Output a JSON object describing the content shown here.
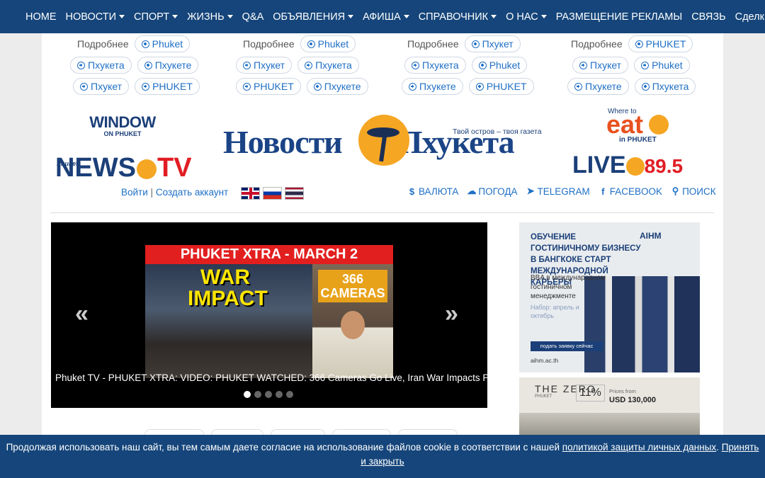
{
  "nav": {
    "items": [
      {
        "label": "HOME",
        "dropdown": false
      },
      {
        "label": "НОВОСТИ",
        "dropdown": true
      },
      {
        "label": "СПОРТ",
        "dropdown": true
      },
      {
        "label": "ЖИЗНЬ",
        "dropdown": true
      },
      {
        "label": "Q&A",
        "dropdown": false
      },
      {
        "label": "ОБЪЯВЛЕНИЯ",
        "dropdown": true
      },
      {
        "label": "АФИША",
        "dropdown": true
      },
      {
        "label": "СПРАВОЧНИК",
        "dropdown": true
      },
      {
        "label": "О НАС",
        "dropdown": true
      },
      {
        "label": "РАЗМЕЩЕНИЕ РЕКЛАМЫ",
        "dropdown": false
      },
      {
        "label": "СВЯЗЬ",
        "dropdown": false
      },
      {
        "label": "Сделки",
        "dropdown": false
      }
    ]
  },
  "tags": [
    {
      "label": "Подробнее",
      "rows": [
        [
          "Phuket"
        ],
        [
          "Пхукета",
          "Пхукете"
        ],
        [
          "Пхукет",
          "PHUKET"
        ]
      ]
    },
    {
      "label": "Подробнее",
      "rows": [
        [
          "Phuket"
        ],
        [
          "Пхукет",
          "Пхукета"
        ],
        [
          "PHUKET",
          "Пхукете"
        ]
      ]
    },
    {
      "label": "Подробнее",
      "rows": [
        [
          "Пхукет"
        ],
        [
          "Пхукета",
          "Phuket"
        ],
        [
          "Пхукете",
          "PHUKET"
        ]
      ]
    },
    {
      "label": "Подробнее",
      "rows": [
        [
          "PHUKET"
        ],
        [
          "Пхукет",
          "Phuket"
        ],
        [
          "Пхукете",
          "Пхукета"
        ]
      ]
    }
  ],
  "header": {
    "window_logo": "WINDOW",
    "window_logo_sub": "ON PHUKET",
    "newstv_small": "Phuket",
    "newstv_news": "NEWS",
    "newstv_tv": "TV",
    "main_logo_left": "Новости",
    "main_logo_right": "Пхукета",
    "slogan": "Твой остров – твоя газета",
    "eat_where": "Where to",
    "eat_word": "eat",
    "eat_in": "in PHUKET",
    "live_word": "LIVE",
    "live_freq": "89.5",
    "login": "Войти",
    "separator": "|",
    "register": "Создать аккаунт",
    "tools": [
      {
        "icon": "dollar-icon",
        "glyph": "$",
        "label": "ВАЛЮТА"
      },
      {
        "icon": "weather-icon",
        "glyph": "☁",
        "label": "ПОГОДА"
      },
      {
        "icon": "telegram-icon",
        "glyph": "➤",
        "label": "TELEGRAM"
      },
      {
        "icon": "facebook-icon",
        "glyph": "f",
        "label": "FACEBOOK"
      },
      {
        "icon": "search-icon",
        "glyph": "⚲",
        "label": "ПОИСК"
      }
    ]
  },
  "slider": {
    "banner": "PHUKET XTRA - MARCH 2",
    "war_text": "WAR IMPACT",
    "cameras_text": "366 CAMERAS",
    "caption": "Phuket TV - PHUKET XTRA: VIDEO: PHUKET WATCHED: 366 Cameras Go Live, Iran War Impacts Phuket...",
    "prev": "«",
    "next": "»",
    "dot_count": 5,
    "active_dot": 0
  },
  "ads": {
    "ad1": {
      "headline": "ОБУЧЕНИЕ ГОСТИНИЧНОМУ БИЗНЕСУ В БАНГКОКЕ СТАРТ МЕЖДУНАРОДНОЙ КАРЬЕРЫ",
      "logo": "AIHM",
      "sub": "BBA в международном гостиничном менеджменте",
      "nabor": "Набор: апрель и октябрь",
      "cta": "подать заявку сейчас",
      "url": "aihm.ac.th"
    },
    "ad2": {
      "brand": "THE ZERO",
      "brand_sub": "PHUKET",
      "roi": "11%",
      "price_label": "Prices from",
      "price_value": "USD 130,000"
    }
  },
  "cookie": {
    "text": "Продолжая использовать наш сайт, вы тем самым даете согласие на использование файлов cookie в соответствии с нашей",
    "policy_link": "политикой защиты личных данных",
    "period": ".",
    "accept_link": "Принять и закрыть"
  },
  "colors": {
    "nav_bg": "#15457a",
    "link": "#1f6fc5",
    "accent_orange": "#f5a623",
    "accent_red": "#e11d24"
  }
}
